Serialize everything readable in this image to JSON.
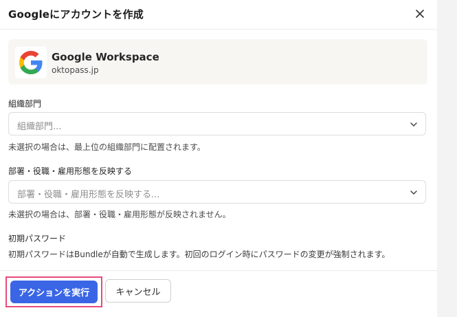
{
  "dialog": {
    "title": "Googleにアカウントを作成"
  },
  "service": {
    "name": "Google Workspace",
    "domain": "oktopass.jp",
    "logo_icon": "google-g-logo"
  },
  "fields": {
    "org_unit": {
      "label": "組織部門",
      "placeholder": "組織部門...",
      "hint": "未選択の場合は、最上位の組織部門に配置されます。"
    },
    "dept": {
      "label": "部署・役職・雇用形態を反映する",
      "placeholder": "部署・役職・雇用形態を反映する...",
      "hint": "未選択の場合は、部署・役職・雇用形態が反映されません。"
    },
    "password": {
      "label": "初期パスワード",
      "description": "初期パスワードはBundleが自動で生成します。初回のログイン時にパスワードの変更が強制されます。"
    }
  },
  "actions": {
    "execute": "アクションを実行",
    "cancel": "キャンセル"
  },
  "colors": {
    "primary": "#3a66e6",
    "highlight": "#e84a7a"
  }
}
